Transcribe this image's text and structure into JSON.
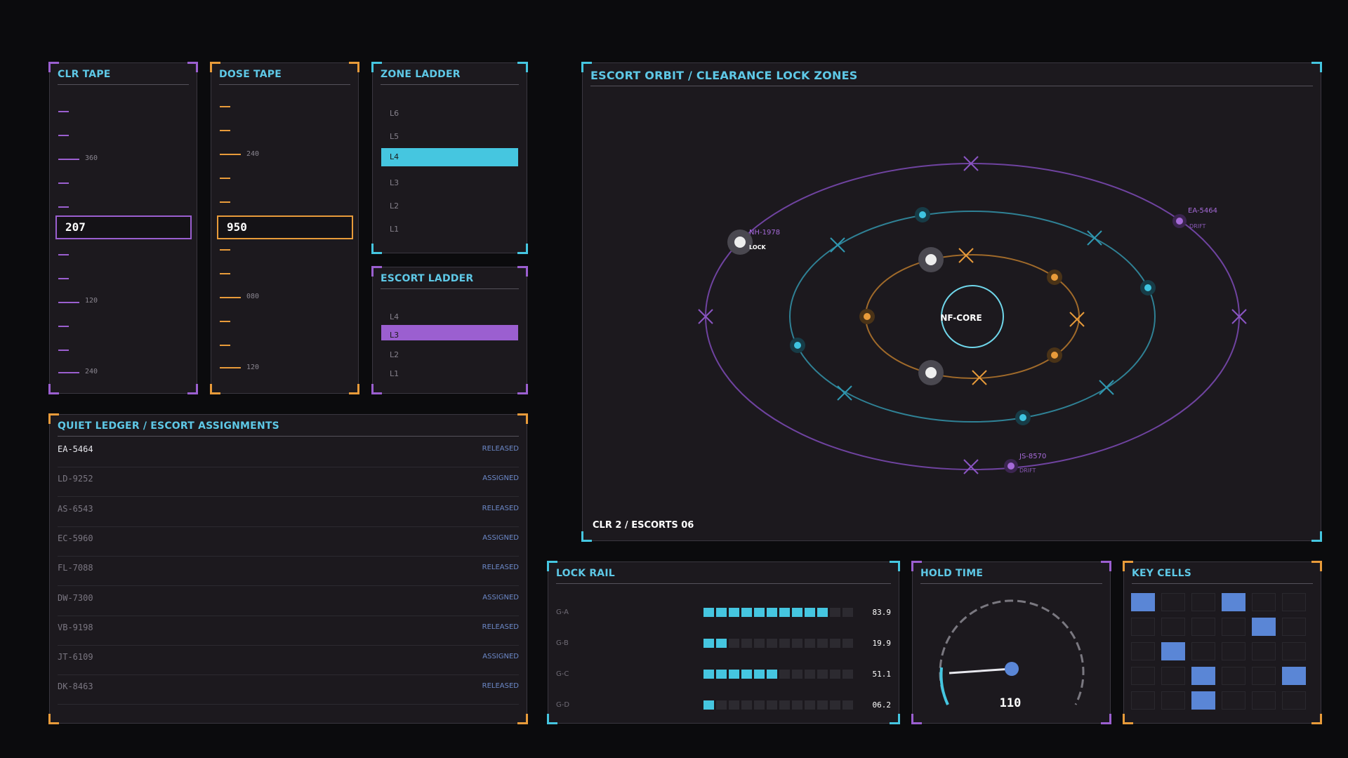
{
  "clr_tape": {
    "title": "CLR TAPE",
    "value": "207",
    "labels": [
      "360",
      "120",
      "240"
    ]
  },
  "dose_tape": {
    "title": "DOSE TAPE",
    "value": "950",
    "labels": [
      "240",
      "080",
      "120"
    ]
  },
  "zone_ladder": {
    "title": "ZONE LADDER",
    "rungs": [
      "L6",
      "L5",
      "L4",
      "L3",
      "L2",
      "L1"
    ],
    "active": "L4"
  },
  "escort_ladder": {
    "title": "ESCORT LADDER",
    "rungs": [
      "L4",
      "L3",
      "L2",
      "L1"
    ],
    "active": "L3"
  },
  "orbit": {
    "title": "ESCORT ORBIT / CLEARANCE LOCK ZONES",
    "core_label": "NF-CORE",
    "footer": "CLR 2 / ESCORTS 06",
    "tags": [
      {
        "id": "NH-1978",
        "status": "LOCK"
      },
      {
        "id": "EA-5464",
        "status": "DRIFT"
      },
      {
        "id": "JS-8570",
        "status": "DRIFT"
      }
    ]
  },
  "ledger": {
    "title": "QUIET LEDGER / ESCORT ASSIGNMENTS",
    "rows": [
      {
        "id": "EA-5464",
        "status": "RELEASED"
      },
      {
        "id": "LD-9252",
        "status": "ASSIGNED"
      },
      {
        "id": "AS-6543",
        "status": "RELEASED"
      },
      {
        "id": "EC-5960",
        "status": "ASSIGNED"
      },
      {
        "id": "FL-7088",
        "status": "RELEASED"
      },
      {
        "id": "DW-7300",
        "status": "ASSIGNED"
      },
      {
        "id": "VB-9198",
        "status": "RELEASED"
      },
      {
        "id": "JT-6109",
        "status": "ASSIGNED"
      },
      {
        "id": "DK-8463",
        "status": "RELEASED"
      }
    ]
  },
  "lock_rail": {
    "title": "LOCK RAIL",
    "rows": [
      {
        "label": "G-A",
        "value": "83.9",
        "filled": 10,
        "total": 12
      },
      {
        "label": "G-B",
        "value": "19.9",
        "filled": 2,
        "total": 12
      },
      {
        "label": "G-C",
        "value": "51.1",
        "filled": 6,
        "total": 12
      },
      {
        "label": "G-D",
        "value": "06.2",
        "filled": 1,
        "total": 12
      }
    ]
  },
  "hold_time": {
    "title": "HOLD TIME",
    "value": "110"
  },
  "key_cells": {
    "title": "KEY CELLS",
    "active": [
      [
        0,
        0
      ],
      [
        0,
        3
      ],
      [
        1,
        4
      ],
      [
        2,
        1
      ],
      [
        3,
        2
      ],
      [
        3,
        5
      ],
      [
        4,
        2
      ]
    ]
  },
  "colors": {
    "cyan": "#45c6e0",
    "purple": "#9b5fd0",
    "orange": "#e89b3a",
    "blue_cell": "#5a86d6"
  }
}
